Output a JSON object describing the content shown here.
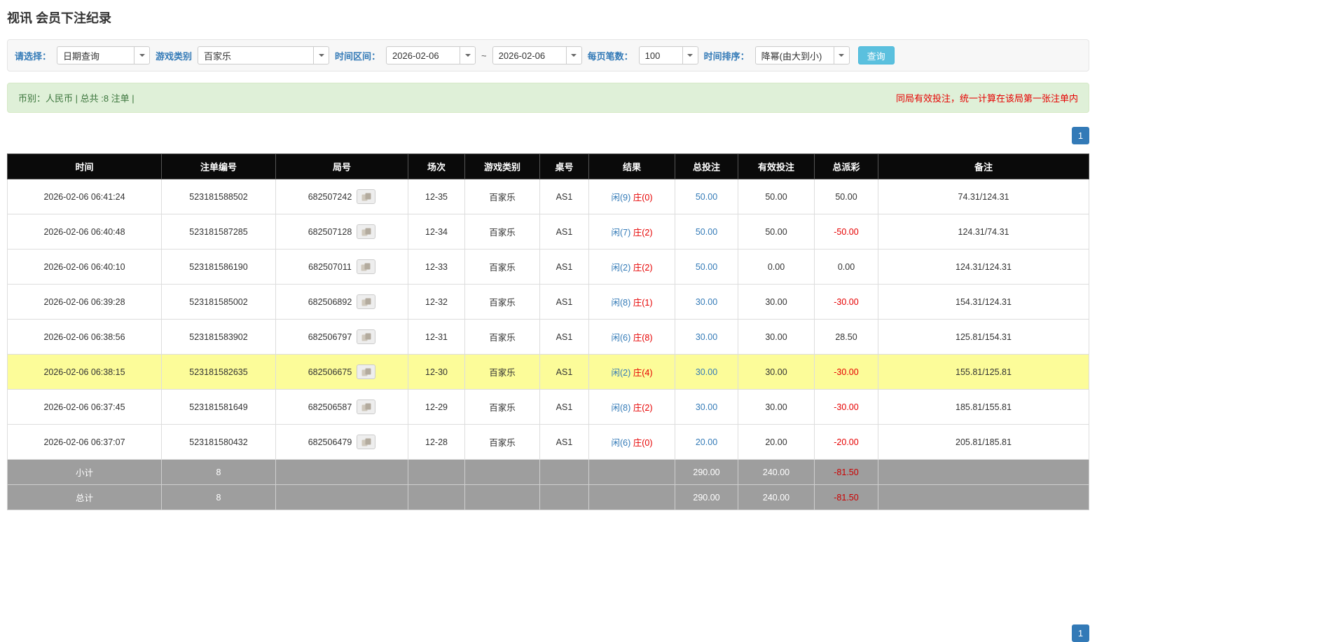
{
  "page_title": "视讯 会员下注纪录",
  "filters": {
    "select_label": "请选择：",
    "select_value": "日期查询",
    "game_label": "游戏类别",
    "game_value": "百家乐",
    "range_label": "时间区间：",
    "date_from": "2026-02-06",
    "range_separator": "~",
    "date_to": "2026-02-06",
    "page_size_label": "每页笔数：",
    "page_size_value": "100",
    "sort_label": "时间排序：",
    "sort_value": "降幂(由大到小)",
    "search_button": "查询"
  },
  "summary": {
    "currency_info": "币别：人民币 | 总共 :8 注单 |",
    "notice": "同局有效投注，统一计算在该局第一张注单内"
  },
  "pagination": {
    "page": "1"
  },
  "icons": {
    "round_detail": "video-replay-icon",
    "combo_caret": "chevron-down-icon"
  },
  "table": {
    "headers": [
      "时间",
      "注单编号",
      "局号",
      "场次",
      "游戏类别",
      "桌号",
      "结果",
      "总投注",
      "有效投注",
      "总派彩",
      "备注"
    ],
    "rows": [
      {
        "time": "2026-02-06 06:41:24",
        "bet_id": "523181588502",
        "round": "682507242",
        "session": "12-35",
        "game": "百家乐",
        "table_no": "AS1",
        "player": "闲(9)",
        "banker": "庄(0)",
        "total_bet": "50.00",
        "valid_bet": "50.00",
        "payout": "50.00",
        "note": "74.31/124.31",
        "highlight": false
      },
      {
        "time": "2026-02-06 06:40:48",
        "bet_id": "523181587285",
        "round": "682507128",
        "session": "12-34",
        "game": "百家乐",
        "table_no": "AS1",
        "player": "闲(7)",
        "banker": "庄(2)",
        "total_bet": "50.00",
        "valid_bet": "50.00",
        "payout": "-50.00",
        "note": "124.31/74.31",
        "highlight": false
      },
      {
        "time": "2026-02-06 06:40:10",
        "bet_id": "523181586190",
        "round": "682507011",
        "session": "12-33",
        "game": "百家乐",
        "table_no": "AS1",
        "player": "闲(2)",
        "banker": "庄(2)",
        "total_bet": "50.00",
        "valid_bet": "0.00",
        "payout": "0.00",
        "note": "124.31/124.31",
        "highlight": false
      },
      {
        "time": "2026-02-06 06:39:28",
        "bet_id": "523181585002",
        "round": "682506892",
        "session": "12-32",
        "game": "百家乐",
        "table_no": "AS1",
        "player": "闲(8)",
        "banker": "庄(1)",
        "total_bet": "30.00",
        "valid_bet": "30.00",
        "payout": "-30.00",
        "note": "154.31/124.31",
        "highlight": false
      },
      {
        "time": "2026-02-06 06:38:56",
        "bet_id": "523181583902",
        "round": "682506797",
        "session": "12-31",
        "game": "百家乐",
        "table_no": "AS1",
        "player": "闲(6)",
        "banker": "庄(8)",
        "total_bet": "30.00",
        "valid_bet": "30.00",
        "payout": "28.50",
        "note": "125.81/154.31",
        "highlight": false
      },
      {
        "time": "2026-02-06 06:38:15",
        "bet_id": "523181582635",
        "round": "682506675",
        "session": "12-30",
        "game": "百家乐",
        "table_no": "AS1",
        "player": "闲(2)",
        "banker": "庄(4)",
        "total_bet": "30.00",
        "valid_bet": "30.00",
        "payout": "-30.00",
        "note": "155.81/125.81",
        "highlight": true
      },
      {
        "time": "2026-02-06 06:37:45",
        "bet_id": "523181581649",
        "round": "682506587",
        "session": "12-29",
        "game": "百家乐",
        "table_no": "AS1",
        "player": "闲(8)",
        "banker": "庄(2)",
        "total_bet": "30.00",
        "valid_bet": "30.00",
        "payout": "-30.00",
        "note": "185.81/155.81",
        "highlight": false
      },
      {
        "time": "2026-02-06 06:37:07",
        "bet_id": "523181580432",
        "round": "682506479",
        "session": "12-28",
        "game": "百家乐",
        "table_no": "AS1",
        "player": "闲(6)",
        "banker": "庄(0)",
        "total_bet": "20.00",
        "valid_bet": "20.00",
        "payout": "-20.00",
        "note": "205.81/185.81",
        "highlight": false
      }
    ],
    "subtotal": {
      "label": "小计",
      "count": "8",
      "total_bet": "290.00",
      "valid_bet": "240.00",
      "payout": "-81.50"
    },
    "total": {
      "label": "总计",
      "count": "8",
      "total_bet": "290.00",
      "valid_bet": "240.00",
      "payout": "-81.50"
    }
  }
}
